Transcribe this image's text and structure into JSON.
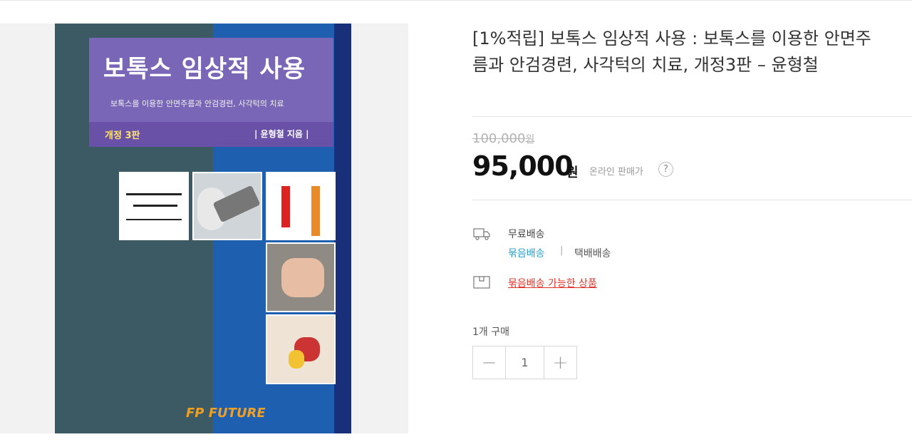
{
  "product": {
    "title": "[1%적립] 보톡스 임상적 사용 : 보톡스를 이용한 안면주름과 안검경련, 사각턱의 치료, 개정3판 – 윤형철",
    "original_price": "100,000",
    "original_unit": "원",
    "sale_price": "95,000",
    "sale_unit": "원",
    "price_label": "온라인 판매가",
    "help_symbol": "?"
  },
  "book_cover": {
    "title": "보톡스 임상적 사용",
    "subtitle": "보톡스를 이용한 안면주름과 안검경련, 사각턱의 치료",
    "edition": "개정 3판",
    "author": "| 윤형철 지음 |",
    "publisher": "FP FUTURE",
    "colors": {
      "left": "#3b5a63",
      "right": "#1f5fb0",
      "title_block": "#7a66b6"
    }
  },
  "shipping": {
    "free_label": "무료배송",
    "bundle_label": "묶음배송",
    "separator": "|",
    "courier_label": "택배배송",
    "bundle_link": "묶음배송 가능한 상품",
    "icons": {
      "truck": "truck-icon",
      "box": "box-icon"
    }
  },
  "quantity": {
    "label": "1개 구매",
    "value": "1",
    "minus": "−",
    "plus": "+"
  },
  "colors": {
    "accent_blue": "#2ba1c8",
    "accent_red": "#e0342c"
  }
}
